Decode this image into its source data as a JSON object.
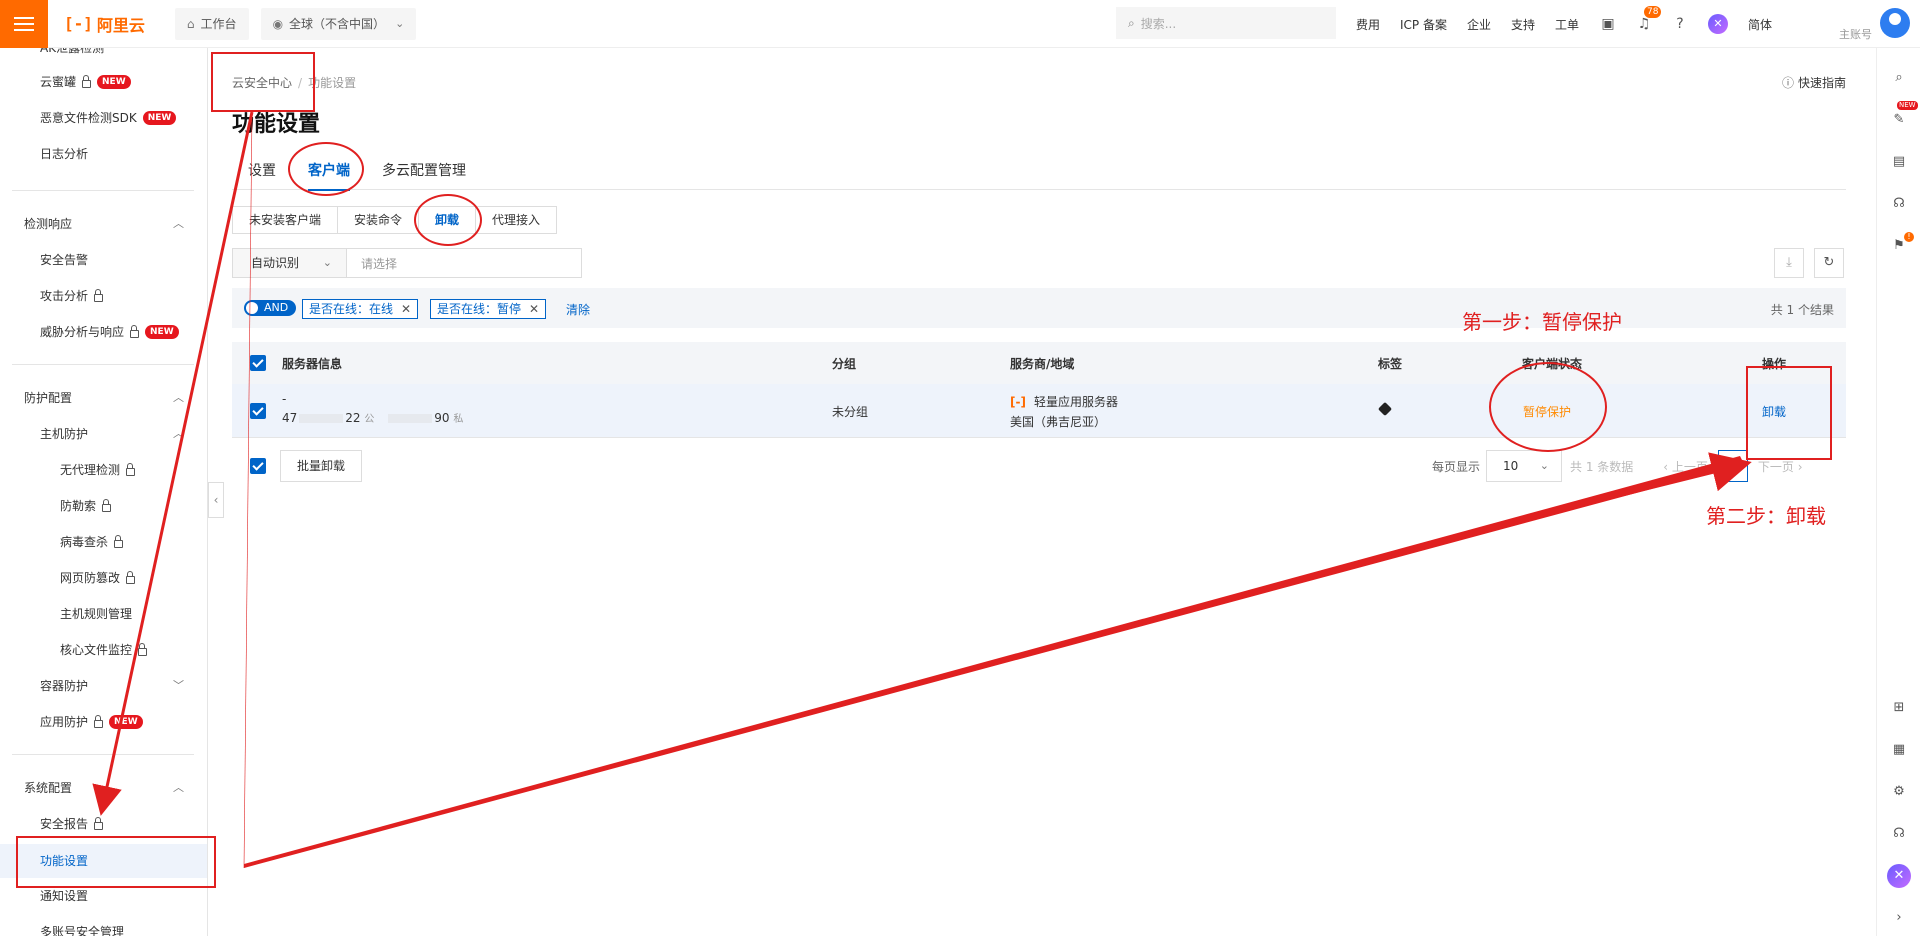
{
  "topbar": {
    "logo_text": "阿里云",
    "logo_mark": "[-]",
    "workbench": "工作台",
    "region": "全球（不含中国）",
    "search_placeholder": "搜索...",
    "links": [
      "费用",
      "ICP 备案",
      "企业",
      "支持",
      "工单"
    ],
    "notification_count": "78",
    "lang": "简体",
    "account_type": "主账号"
  },
  "sidebar": {
    "items_top": [
      {
        "label": "AK泄露检测",
        "lock": false,
        "new": false
      },
      {
        "label": "云蜜罐",
        "lock": true,
        "new": true
      },
      {
        "label": "恶意文件检测SDK",
        "lock": false,
        "new": true
      },
      {
        "label": "日志分析",
        "lock": false,
        "new": false
      }
    ],
    "group_detect": "检测响应",
    "detect_items": [
      {
        "label": "安全告警"
      },
      {
        "label": "攻击分析"
      },
      {
        "label": "威胁分析与响应"
      }
    ],
    "group_protect": "防护配置",
    "host_protect": "主机防护",
    "host_items": [
      "无代理检测",
      "防勒索",
      "病毒查杀",
      "网页防篡改",
      "主机规则管理",
      "核心文件监控"
    ],
    "container": "容器防护",
    "app_protect": "应用防护",
    "group_system": "系统配置",
    "system_items": [
      "安全报告",
      "功能设置",
      "通知设置",
      "多账号安全管理"
    ],
    "new_badge": "NEW"
  },
  "main": {
    "breadcrumb_root": "云安全中心",
    "breadcrumb_current": "功能设置",
    "quick_guide": "快速指南",
    "title": "功能设置",
    "tabs": [
      "设置",
      "客户端",
      "多云配置管理"
    ],
    "subtabs": [
      "未安装客户端",
      "安装命令",
      "卸载",
      "代理接入"
    ],
    "filter_select": "自动识别",
    "filter_placeholder": "请选择",
    "and_label": "AND",
    "filter_tags": [
      "是否在线：在线",
      "是否在线：暂停"
    ],
    "clear": "清除",
    "result_count": "共 1 个结果"
  },
  "table": {
    "columns": [
      "服务器信息",
      "分组",
      "服务商/地域",
      "标签",
      "客户端状态",
      "操作"
    ],
    "rows": [
      {
        "name": "-",
        "ip_pub_start": "47",
        "ip_pub_end": "22",
        "pub_label": "公",
        "ip_priv_end": "90",
        "priv_label": "私",
        "group": "未分组",
        "provider": "轻量应用服务器",
        "region": "美国（弗吉尼亚）",
        "status": "暂停保护",
        "action": "卸载"
      }
    ],
    "batch_uninstall": "批量卸载",
    "per_page_label": "每页显示",
    "per_page": "10",
    "total": "共 1 条数据",
    "prev": "上一页",
    "page": "1",
    "next": "下一页"
  },
  "annotations": {
    "step1": "第一步：暂停保护",
    "step2": "第二步：卸载",
    "color": "#e02020"
  },
  "colors": {
    "brand": "#ff6a00",
    "primary": "#0064c8",
    "status_paused": "#ff8a00"
  }
}
